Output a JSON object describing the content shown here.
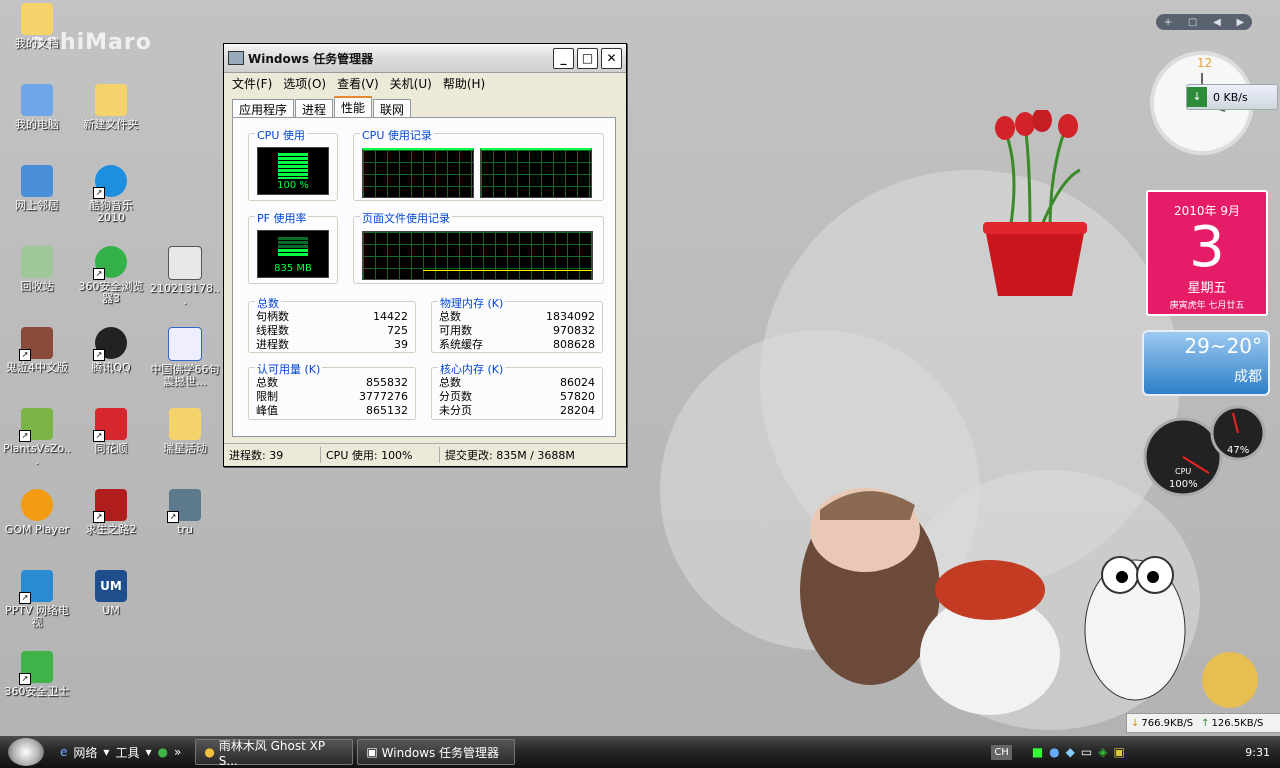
{
  "window": {
    "title": "Windows 任务管理器",
    "menu": [
      "文件(F)",
      "选项(O)",
      "查看(V)",
      "关机(U)",
      "帮助(H)"
    ],
    "tabs": [
      "应用程序",
      "进程",
      "性能",
      "联网"
    ],
    "active_tab": "性能",
    "cpu_usage_label": "CPU 使用",
    "cpu_usage_value": "100 %",
    "cpu_history_label": "CPU 使用记录",
    "pf_label": "PF 使用率",
    "pf_value": "835 MB",
    "pf_history_label": "页面文件使用记录",
    "totals": {
      "title": "总数",
      "handles_label": "句柄数",
      "handles": "14422",
      "threads_label": "线程数",
      "threads": "725",
      "processes_label": "进程数",
      "processes": "39"
    },
    "physical": {
      "title": "物理内存 (K)",
      "total_label": "总数",
      "total": "1834092",
      "available_label": "可用数",
      "available": "970832",
      "cache_label": "系统缓存",
      "cache": "808628"
    },
    "commit": {
      "title": "认可用量 (K)",
      "total_label": "总数",
      "total": "855832",
      "limit_label": "限制",
      "limit": "3777276",
      "peak_label": "峰值",
      "peak": "865132"
    },
    "kernel": {
      "title": "核心内存 (K)",
      "total_label": "总数",
      "total": "86024",
      "paged_label": "分页数",
      "paged": "57820",
      "nonpaged_label": "未分页",
      "nonpaged": "28204"
    },
    "status": {
      "processes": "进程数: 39",
      "cpu": "CPU 使用: 100%",
      "commit": "提交更改: 835M / 3688M"
    }
  },
  "desktop_icons": [
    {
      "label": "我的文档"
    },
    {
      "label": "我的电脑"
    },
    {
      "label": "新建文件夹"
    },
    {
      "label": "网上邻居"
    },
    {
      "label": "酷狗音乐2010"
    },
    {
      "label": "回收站"
    },
    {
      "label": "360安全浏览器3"
    },
    {
      "label": "210213178..."
    },
    {
      "label": "鬼泣4中文版"
    },
    {
      "label": "腾讯QQ"
    },
    {
      "label": "中国佛学66句震撼世..."
    },
    {
      "label": "PlantsVsZo..."
    },
    {
      "label": "同花顺"
    },
    {
      "label": "瑞星活动"
    },
    {
      "label": "GOM Player"
    },
    {
      "label": "求生之路2"
    },
    {
      "label": "tru"
    },
    {
      "label": "PPTV 网络电视"
    },
    {
      "label": "UM"
    },
    {
      "label": "360安全卫士"
    }
  ],
  "gadgets": {
    "net_speed": "0 KB/s",
    "calendar": {
      "year_month": "2010年 9月",
      "day": "3",
      "weekday": "星期五",
      "lunar": "庚寅虎年 七月廿五"
    },
    "weather": {
      "temp": "29~20°",
      "city": "成都"
    },
    "cpu_meter": {
      "cpu": "100%",
      "mem": "47%",
      "cpu_label": "CPU"
    },
    "down_speed": "766.9KB/S",
    "up_speed": "126.5KB/S"
  },
  "taskbar": {
    "quick": [
      "网络",
      "工具"
    ],
    "buttons": [
      "雨林木风 Ghost XP S...",
      "Windows 任务管理器"
    ],
    "lang": "CH",
    "time": "9:31"
  },
  "watermark": "ashiMaro"
}
